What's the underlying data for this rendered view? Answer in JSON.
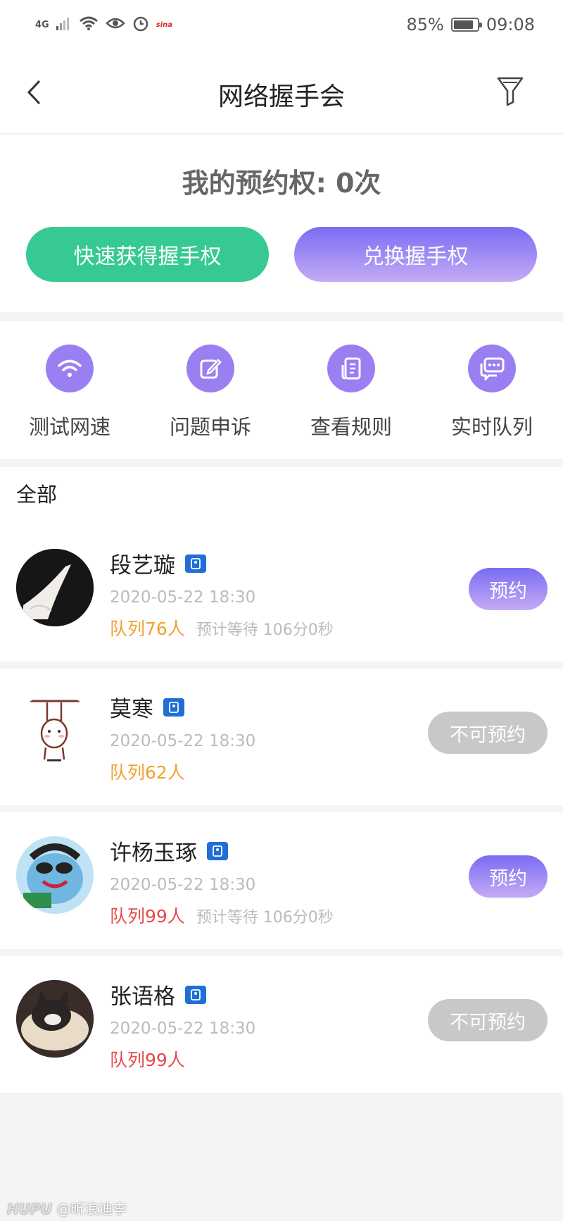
{
  "status_bar": {
    "network": "4G",
    "sina": "sina",
    "battery": "85%",
    "battery_level": 0.85,
    "time": "09:08"
  },
  "nav": {
    "title": "网络握手会"
  },
  "quota": {
    "text": "我的预约权: 0次",
    "quick_button": "快速获得握手权",
    "exchange_button": "兑换握手权"
  },
  "shortcuts": [
    {
      "label": "测试网速",
      "icon": "wifi-icon"
    },
    {
      "label": "问题申诉",
      "icon": "edit-icon"
    },
    {
      "label": "查看规则",
      "icon": "document-icon"
    },
    {
      "label": "实时队列",
      "icon": "chat-icon"
    }
  ],
  "list": {
    "header": "全部",
    "items": [
      {
        "name": "段艺璇",
        "date": "2020-05-22 18:30",
        "queue": "队列76人",
        "queue_color": "#f0a030",
        "wait": "预计等待 106分0秒",
        "button": "预约",
        "available": true
      },
      {
        "name": "莫寒",
        "date": "2020-05-22 18:30",
        "queue": "队列62人",
        "queue_color": "#f0a030",
        "wait": "",
        "button": "不可预约",
        "available": false
      },
      {
        "name": "许杨玉琢",
        "date": "2020-05-22 18:30",
        "queue": "队列99人",
        "queue_color": "#e8484a",
        "wait": "预计等待 106分0秒",
        "button": "预约",
        "available": true
      },
      {
        "name": "张语格",
        "date": "2020-05-22 18:30",
        "queue": "队列99人",
        "queue_color": "#e8484a",
        "wait": "",
        "button": "不可预约",
        "available": false
      }
    ]
  },
  "watermark": {
    "brand": "HUPU",
    "handle": "@昕浪迪李"
  },
  "colors": {
    "green": "#36c993",
    "purple": "#8b78f2",
    "icon_purple": "#9a7ff2",
    "disabled_gray": "#c8c8c8"
  }
}
